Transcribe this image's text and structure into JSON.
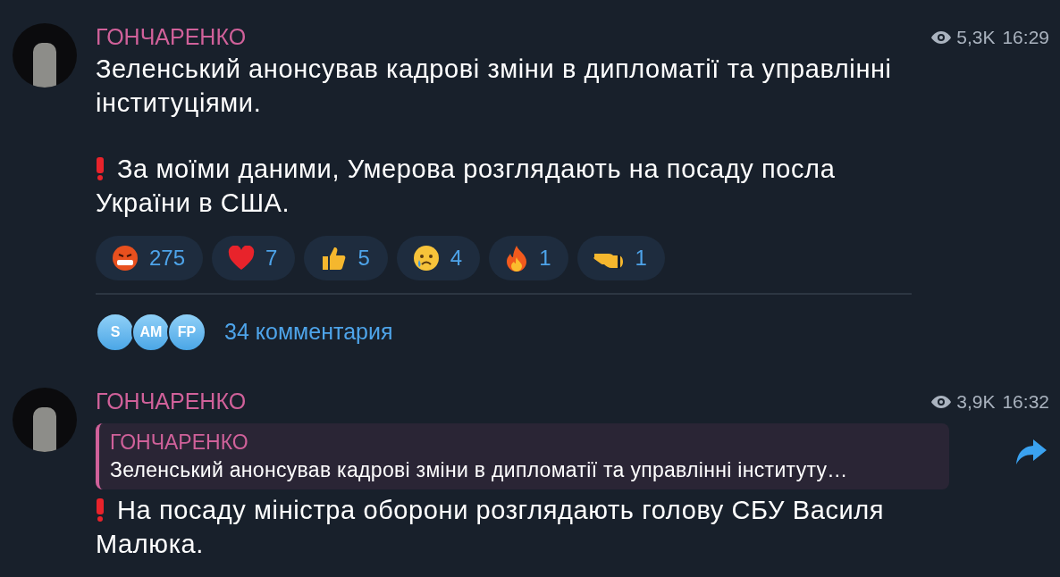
{
  "messages": [
    {
      "author": "ГОНЧАРЕНКО",
      "views": "5,3K",
      "time": "16:29",
      "paragraphs": [
        {
          "kind": "plain",
          "text": "Зеленський анонсував кадрові зміни в дипломатії та управлінні інституціями."
        },
        {
          "kind": "alert",
          "text": "За моїми даними, Умерова розглядають на посаду посла України в США."
        }
      ],
      "reactions": [
        {
          "kind": "angry",
          "count": "275"
        },
        {
          "kind": "heart",
          "count": "7"
        },
        {
          "kind": "thumbs",
          "count": "5"
        },
        {
          "kind": "cry",
          "count": "4"
        },
        {
          "kind": "fire",
          "count": "1"
        },
        {
          "kind": "point",
          "count": "1"
        }
      ],
      "comments": {
        "avatars": [
          "S",
          "AM",
          "FP"
        ],
        "label": "34 комментария"
      }
    },
    {
      "author": "ГОНЧАРЕНКО",
      "views": "3,9K",
      "time": "16:32",
      "reply": {
        "author": "ГОНЧАРЕНКО",
        "text": "Зеленський анонсував кадрові зміни в дипломатії та управлінні інституту…"
      },
      "paragraphs": [
        {
          "kind": "alert",
          "text": "На посаду міністра оборони розглядають голову СБУ Василя Малюка."
        }
      ],
      "share": true
    }
  ]
}
